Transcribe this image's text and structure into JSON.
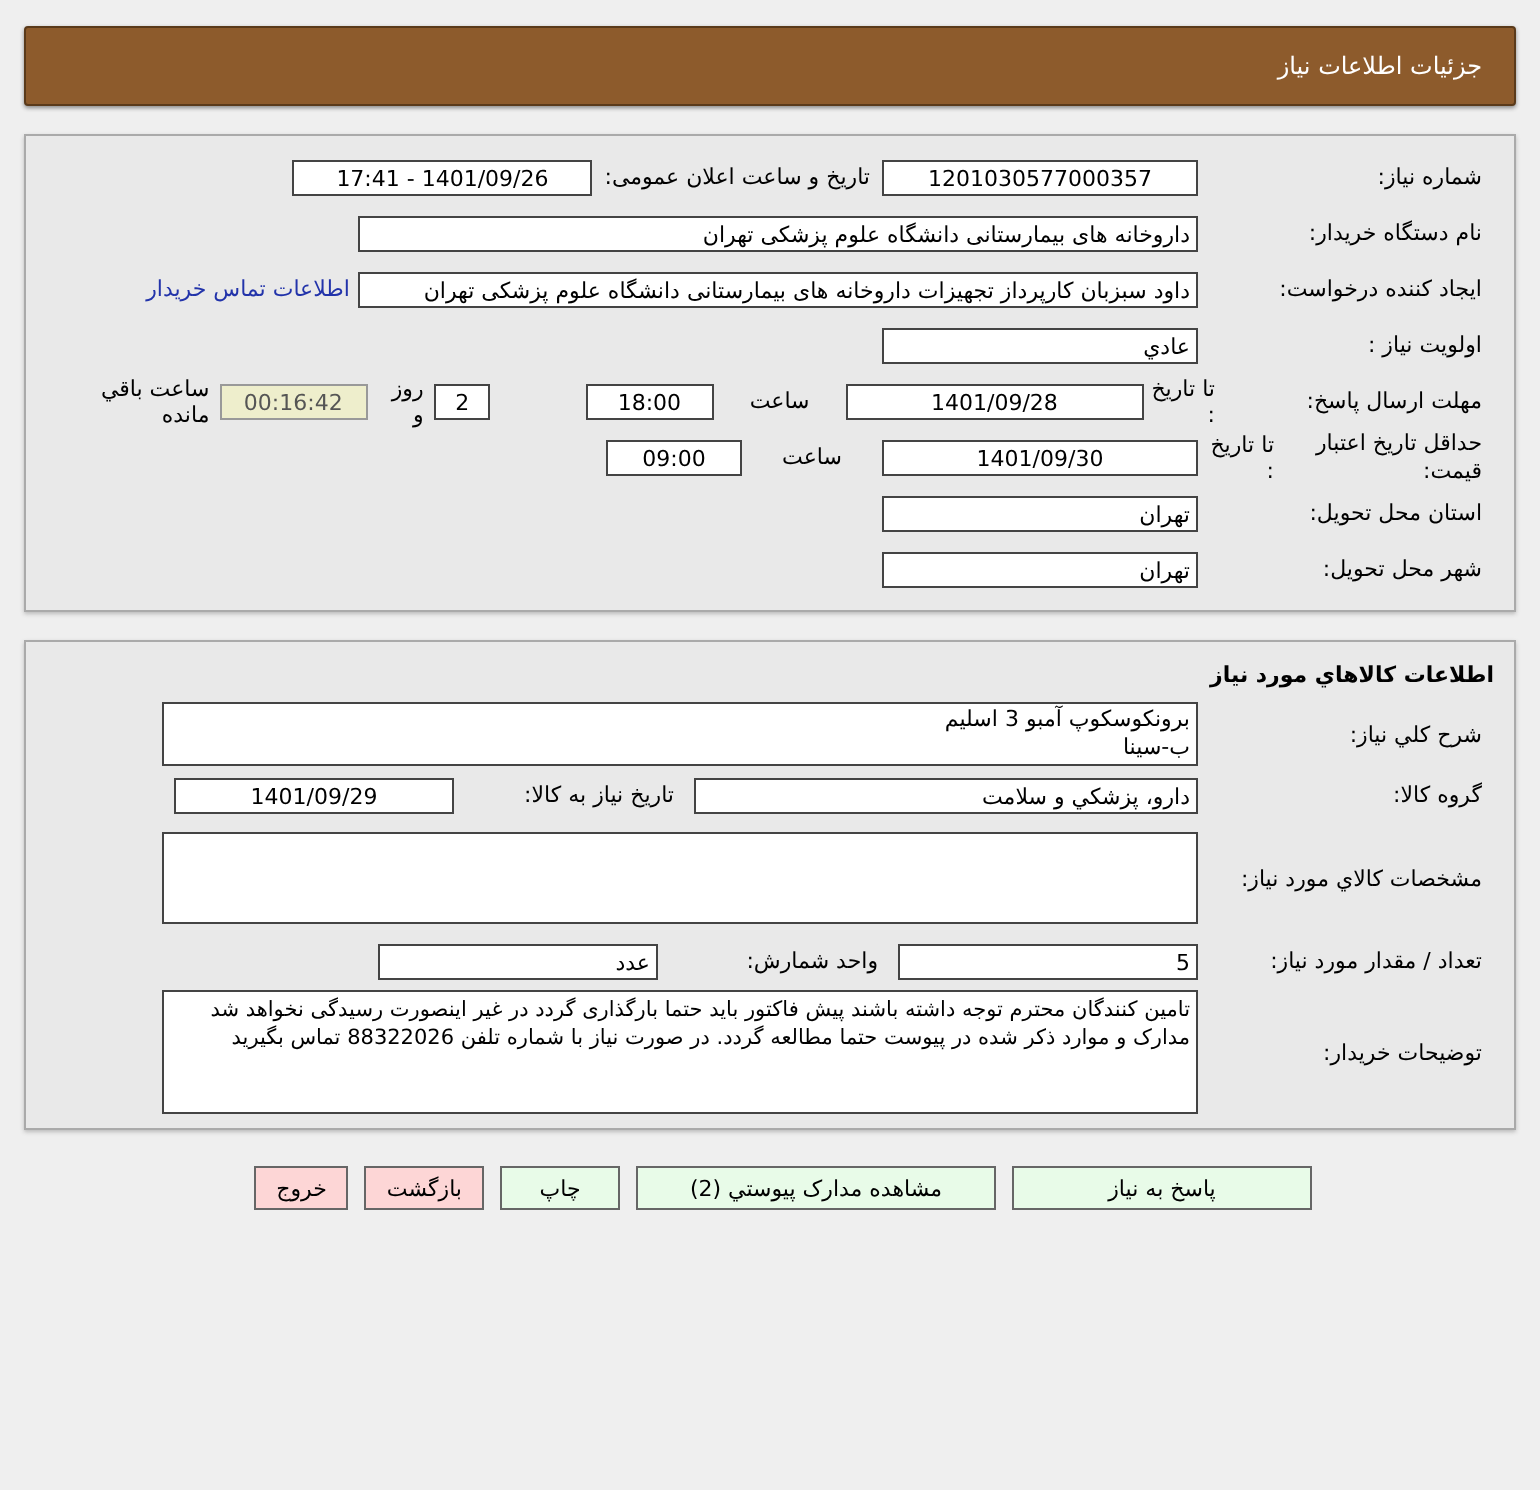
{
  "header": {
    "title": "جزئیات اطلاعات نیاز"
  },
  "need_info": {
    "need_number": {
      "label": "شماره نیاز:",
      "value": "1201030577000357"
    },
    "announce_date": {
      "label": "تاریخ و ساعت اعلان عمومی:",
      "value": "1401/09/26 - 17:41"
    },
    "buyer_org": {
      "label": "نام دستگاه خریدار:",
      "value": "داروخانه های بیمارستانی دانشگاه علوم پزشکی تهران"
    },
    "requester": {
      "label": "ایجاد کننده درخواست:",
      "value": "داود سبزبان کارپرداز تجهیزات داروخانه های بیمارستانی دانشگاه علوم پزشکی تهران",
      "link": "اطلاعات تماس خریدار"
    },
    "priority": {
      "label": "اولویت نیاز :",
      "value": "عادي"
    },
    "response_deadline": {
      "label": "مهلت ارسال پاسخ:",
      "to_date_label": "تا تاریخ :",
      "date": "1401/09/28",
      "time_label": "ساعت",
      "time": "18:00",
      "days": "2",
      "days_label": "روز و",
      "remaining": "00:16:42",
      "remaining_label": "ساعت باقي مانده"
    },
    "price_validity": {
      "label": "حداقل تاریخ اعتبار قیمت:",
      "to_date_label": "تا تاریخ :",
      "date": "1401/09/30",
      "time_label": "ساعت",
      "time": "09:00"
    },
    "delivery_province": {
      "label": "استان محل تحویل:",
      "value": "تهران"
    },
    "delivery_city": {
      "label": "شهر محل تحویل:",
      "value": "تهران"
    }
  },
  "goods_info": {
    "title": "اطلاعات کالاهاي مورد نیاز",
    "general_description": {
      "label": "شرح کلي نیاز:",
      "lines": [
        "برونکوسکوپ آمبو 3 اسلیم",
        "ب-سینا"
      ]
    },
    "goods_group": {
      "label": "گروه کالا:",
      "value": "دارو، پزشکي و سلامت"
    },
    "need_date": {
      "label": "تاریخ نیاز به کالا:",
      "value": "1401/09/29"
    },
    "specifications": {
      "label": "مشخصات کالاي مورد نیاز:"
    },
    "quantity": {
      "label": "تعداد / مقدار مورد نیاز:",
      "value": "5"
    },
    "unit": {
      "label": "واحد شمارش:",
      "value": "عدد"
    },
    "buyer_notes": {
      "label": "توضیحات خریدار:",
      "value": "تامین کنندگان محترم توجه داشته باشند پیش فاکتور باید حتما بارگذاری گردد در غیر اینصورت رسیدگی نخواهد شد مدارک و موارد ذکر شده در پیوست حتما مطالعه گردد. در صورت نیاز با شماره تلفن 88322026 تماس بگیرید"
    }
  },
  "buttons": [
    {
      "label": "پاسخ به نیاز",
      "kind": "normal"
    },
    {
      "label": "مشاهده مدارک پیوستي (2)",
      "kind": "normal"
    },
    {
      "label": "چاپ",
      "kind": "normal"
    },
    {
      "label": "بازگشت",
      "kind": "exit"
    },
    {
      "label": "خروج",
      "kind": "exit"
    }
  ]
}
